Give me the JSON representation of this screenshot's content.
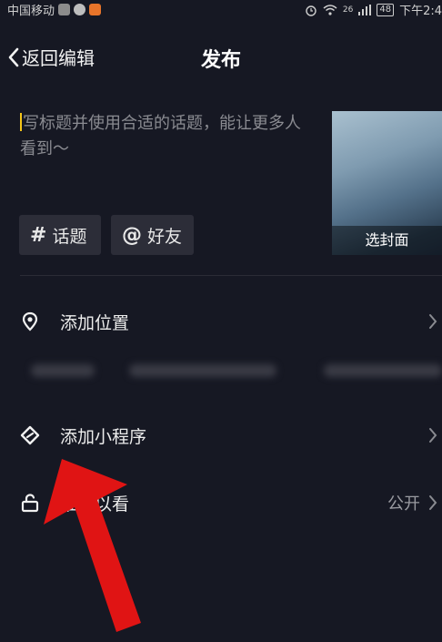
{
  "status_bar": {
    "carrier": "中国移动",
    "signal_badge": "26",
    "battery": "48",
    "time": "下午2:4"
  },
  "nav": {
    "back_label": "返回编辑",
    "title": "发布"
  },
  "caption": {
    "placeholder": "写标题并使用合适的话题，能让更多人看到～"
  },
  "cover": {
    "label": "选封面"
  },
  "tags": [
    {
      "symbol": "#",
      "label": "话题"
    },
    {
      "symbol": "@",
      "label": "好友"
    }
  ],
  "rows": {
    "location": {
      "label": "添加位置",
      "icon": "location-pin-icon"
    },
    "mini_program": {
      "label": "添加小程序",
      "icon": "mini-program-icon"
    },
    "visibility": {
      "label": "谁可以看",
      "value": "公开",
      "icon": "unlock-icon"
    }
  },
  "colors": {
    "background": "#161823",
    "cursor": "#f5c518",
    "arrow": "#e01414"
  }
}
